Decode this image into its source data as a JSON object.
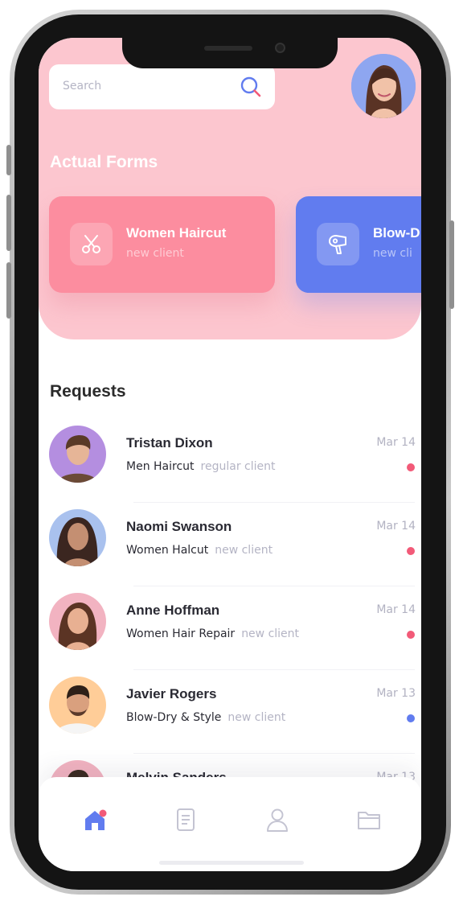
{
  "search": {
    "placeholder": "Search",
    "icon": "search-icon"
  },
  "profile": {
    "avatar": "user-avatar"
  },
  "forms": {
    "title": "Actual Forms",
    "cards": [
      {
        "title": "Women Haircut",
        "subtitle": "new client",
        "icon": "scissors-icon",
        "color": "#fc8d9f"
      },
      {
        "title": "Blow-D",
        "subtitle": "new cli",
        "icon": "hair-dryer-icon",
        "color": "#617cef"
      }
    ]
  },
  "requests": {
    "title": "Requests",
    "items": [
      {
        "name": "Tristan Dixon",
        "service": "Men Haircut",
        "client_type": "regular client",
        "date": "Mar 14",
        "status_color": "#f25a78",
        "avatar_bg": "#b48ee0"
      },
      {
        "name": "Naomi Swanson",
        "service": "Women Halcut",
        "client_type": "new client",
        "date": "Mar 14",
        "status_color": "#f25a78",
        "avatar_bg": "#a9c1ee"
      },
      {
        "name": "Anne Hoffman",
        "service": "Women Hair Repair",
        "client_type": "new client",
        "date": "Mar 14",
        "status_color": "#f25a78",
        "avatar_bg": "#f2b3c1"
      },
      {
        "name": "Javier Rogers",
        "service": "Blow-Dry & Style",
        "client_type": "new client",
        "date": "Mar 13",
        "status_color": "#617cef",
        "avatar_bg": "#ffcd98"
      },
      {
        "name": "Melvin Sanders",
        "service": "",
        "client_type": "",
        "date": "Mar 13",
        "status_color": "#f25a78",
        "avatar_bg": "#f2b3c1"
      }
    ]
  },
  "nav": {
    "items": [
      {
        "name": "home",
        "icon": "home-icon",
        "active": true
      },
      {
        "name": "documents",
        "icon": "document-icon",
        "active": false
      },
      {
        "name": "profile",
        "icon": "user-icon",
        "active": false
      },
      {
        "name": "folder",
        "icon": "folder-icon",
        "active": false
      }
    ],
    "active_color": "#617cef",
    "notification_color": "#f25a78"
  }
}
